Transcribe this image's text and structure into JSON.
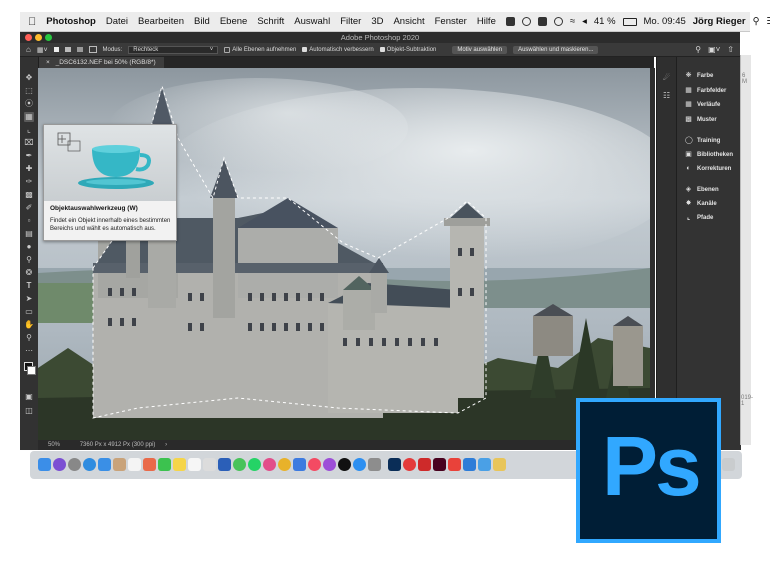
{
  "menubar": {
    "apple_icon": "apple-logo",
    "items": [
      "Photoshop",
      "Datei",
      "Bearbeiten",
      "Bild",
      "Ebene",
      "Schrift",
      "Auswahl",
      "Filter",
      "3D",
      "Ansicht",
      "Fenster",
      "Hilfe"
    ],
    "battery": "41 %",
    "clock": "Mo. 09:45",
    "user": "Jörg Rieger"
  },
  "window": {
    "title": "Adobe Photoshop 2020",
    "traffic_colors": [
      "#ff5f57",
      "#febc2e",
      "#28c840"
    ]
  },
  "options_bar": {
    "mode_label": "Modus:",
    "mode_value": "Rechteck",
    "sample_all": "Alle Ebenen aufnehmen",
    "auto_enhance": "Automatisch verbessern",
    "object_subtract": "Objekt-Subtraktion",
    "select_subject": "Motiv auswählen",
    "select_mask": "Auswählen und maskieren..."
  },
  "document": {
    "tab": "_DSC6132.NEF bei 50% (RGB/8*)",
    "tab_close": "×",
    "zoom": "50%",
    "dimensions": "7360 Px x 4912 Px (300 ppi)",
    "status_arrow": "›"
  },
  "tooltip": {
    "title": "Objektauswahlwerkzeug (W)",
    "description": "Findet ein Objekt innerhalb eines bestimmten Bereichs und wählt es automatisch aus."
  },
  "panels": [
    {
      "label": "Farbe",
      "icon": "color-wheel-icon"
    },
    {
      "label": "Farbfelder",
      "icon": "swatches-grid-icon"
    },
    {
      "label": "Verläufe",
      "icon": "gradient-icon"
    },
    {
      "label": "Muster",
      "icon": "pattern-icon"
    },
    {
      "label": "Training",
      "icon": "lightbulb-icon"
    },
    {
      "label": "Bibliotheken",
      "icon": "library-icon"
    },
    {
      "label": "Korrekturen",
      "icon": "adjustments-icon"
    },
    {
      "label": "Ebenen",
      "icon": "layers-icon"
    },
    {
      "label": "Kanäle",
      "icon": "channels-icon"
    },
    {
      "label": "Pfade",
      "icon": "paths-icon"
    }
  ],
  "background_window": {
    "text1": "6 M",
    "text2": "019-1"
  },
  "logo": {
    "text": "Ps",
    "bg": "#001e36",
    "fg": "#31a8ff"
  }
}
